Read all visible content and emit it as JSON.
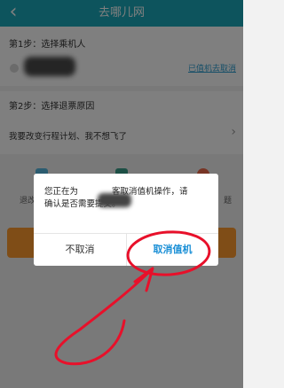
{
  "header": {
    "title": "去哪儿网",
    "back_icon": "back-arrow-icon"
  },
  "step1": {
    "label": "第1步：选择乘机人",
    "link": "已值机去取消"
  },
  "step2": {
    "label": "第2步：选择退票原因",
    "reason": "我要改变行程计划、我不想飞了"
  },
  "options": [
    {
      "label": "退改",
      "color": "#57b8e0"
    },
    {
      "label": "",
      "color": "#3a9f8a"
    },
    {
      "label": "题",
      "color": "#ef6a4a"
    }
  ],
  "dialog": {
    "message_line1_prefix": "您正在为",
    "message_line1_suffix": "客取消值机操作，请",
    "message_line2": "确认是否需要提交。",
    "cancel_label": "不取消",
    "confirm_label": "取消值机"
  },
  "colors": {
    "header": "#1ba9ba",
    "link": "#2e9fd1",
    "confirm": "#1a8fd6",
    "annotation": "#e8102a",
    "primary_button": "#ff9a2e"
  }
}
